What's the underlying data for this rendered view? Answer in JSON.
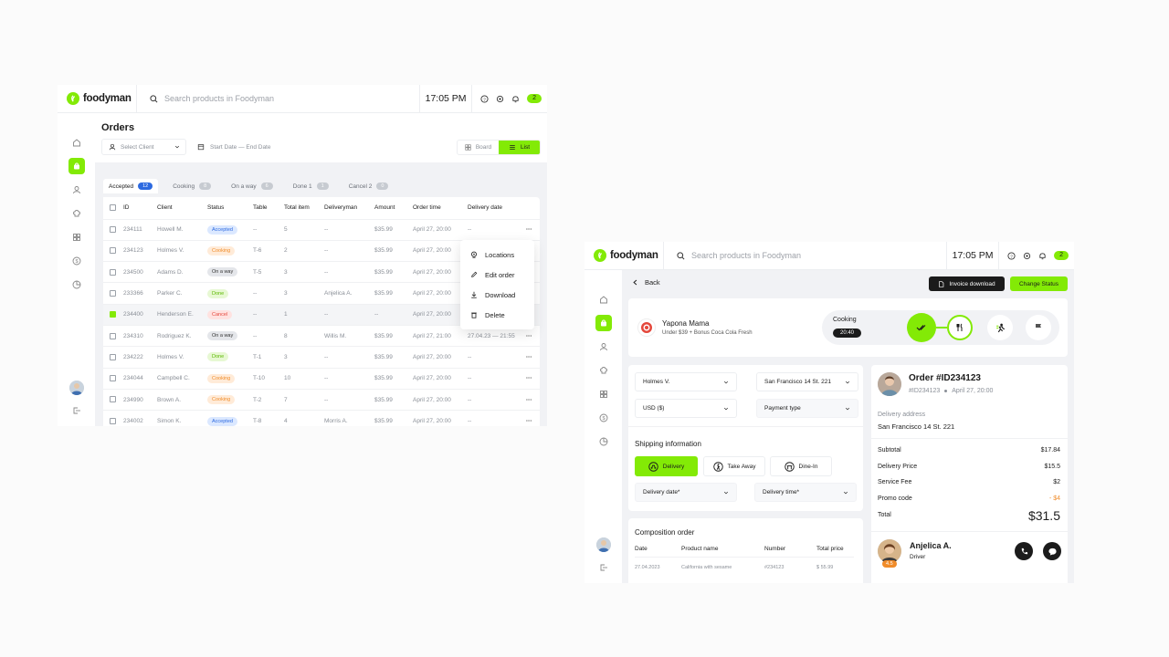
{
  "brand": "foodyman",
  "left": {
    "search_placeholder": "Search products in Foodyman",
    "time": "17:05 PM",
    "notif_count": "2",
    "page_title": "Orders",
    "client_select": "Select Client",
    "date_range": "Start Date — End Date",
    "view_board": "Board",
    "view_list": "List",
    "tabs": [
      {
        "label": "Accepted",
        "count": "12"
      },
      {
        "label": "Cooking",
        "count": "8"
      },
      {
        "label": "On a way",
        "count": "6"
      },
      {
        "label": "Done 1",
        "count": "1"
      },
      {
        "label": "Cancel 2",
        "count": "0"
      }
    ],
    "columns": [
      "ID",
      "Client",
      "Status",
      "Table",
      "Total item",
      "Deliveryman",
      "Amount",
      "Order time",
      "Delivery date"
    ],
    "rows": [
      {
        "id": "234111",
        "client": "Howell M.",
        "status": "Accepted",
        "table": "--",
        "items": "5",
        "deliveryman": "--",
        "amount": "$35.99",
        "time": "April 27, 20:00",
        "delivery": "--",
        "more": "···"
      },
      {
        "id": "234123",
        "client": "Holmes V.",
        "status": "Cooking",
        "table": "T-6",
        "items": "2",
        "deliveryman": "--",
        "amount": "$35.99",
        "time": "April 27, 20:00",
        "delivery": "",
        "more": ""
      },
      {
        "id": "234500",
        "client": "Adams D.",
        "status": "On a way",
        "table": "T-5",
        "items": "3",
        "deliveryman": "--",
        "amount": "$35.99",
        "time": "April 27, 20:00",
        "delivery": "",
        "more": ""
      },
      {
        "id": "233366",
        "client": "Parker C.",
        "status": "Done",
        "table": "--",
        "items": "3",
        "deliveryman": "Anjelica A.",
        "amount": "$35.99",
        "time": "April 27, 20:00",
        "delivery": "",
        "more": ""
      },
      {
        "id": "234400",
        "client": "Henderson E.",
        "status": "Cancel",
        "table": "--",
        "items": "1",
        "deliveryman": "--",
        "amount": "--",
        "time": "April 27, 20:00",
        "delivery": "",
        "more": ""
      },
      {
        "id": "234310",
        "client": "Rodriguez K.",
        "status": "On a way",
        "table": "--",
        "items": "8",
        "deliveryman": "Willis M.",
        "amount": "$35.99",
        "time": "April 27, 21:00",
        "delivery": "27.04.23 — 21:55",
        "more": "···"
      },
      {
        "id": "234222",
        "client": "Holmes V.",
        "status": "Done",
        "table": "T-1",
        "items": "3",
        "deliveryman": "--",
        "amount": "$35.99",
        "time": "April 27, 20:00",
        "delivery": "--",
        "more": "···"
      },
      {
        "id": "234044",
        "client": "Campbell C.",
        "status": "Cooking",
        "table": "T-10",
        "items": "10",
        "deliveryman": "--",
        "amount": "$35.99",
        "time": "April 27, 20:00",
        "delivery": "--",
        "more": "···"
      },
      {
        "id": "234990",
        "client": "Brown A.",
        "status": "Cooking",
        "table": "T-2",
        "items": "7",
        "deliveryman": "--",
        "amount": "$35.99",
        "time": "April 27, 20:00",
        "delivery": "--",
        "more": "···"
      },
      {
        "id": "234002",
        "client": "Simon K.",
        "status": "Accepted",
        "table": "T-8",
        "items": "4",
        "deliveryman": "Morris A.",
        "amount": "$35.99",
        "time": "April 27, 20:00",
        "delivery": "--",
        "more": "···"
      }
    ],
    "context_menu": [
      "Locations",
      "Edit order",
      "Download",
      "Delete"
    ]
  },
  "right": {
    "search_placeholder": "Search products in Foodyman",
    "time": "17:05 PM",
    "notif_count": "2",
    "back": "Back",
    "invoice": "Invoice download",
    "change_status": "Change Status",
    "restaurant": "Yapona Mama",
    "promo": "Under $39 + Bonus Coca Cola Fresh",
    "status_label": "Cooking",
    "status_time": "20:40",
    "client": "Holmes V.",
    "address_select": "San Francisco 14 St. 221",
    "currency": "USD ($)",
    "payment": "Payment type",
    "shipping_title": "Shipping information",
    "ship_options": [
      "Delivery",
      "Take Away",
      "Dine-In"
    ],
    "delivery_date": "Delivery date*",
    "delivery_time": "Delivery time*",
    "composition_title": "Composition order",
    "comp_columns": [
      "Date",
      "Product name",
      "Number",
      "Total price"
    ],
    "comp_row": [
      "27.04.2023",
      "California with sesame",
      "#234123",
      "$ 55.99"
    ],
    "order_title": "Order #ID234123",
    "order_id": "#ID234123",
    "order_date": "April 27, 20:00",
    "address_label": "Delivery address",
    "address": "San Francisco 14 St. 221",
    "summary": [
      {
        "label": "Subtotal",
        "value": "$17.84"
      },
      {
        "label": "Delivery Price",
        "value": "$15.5"
      },
      {
        "label": "Service Fee",
        "value": "$2"
      },
      {
        "label": "Promo code",
        "value": "- $4"
      }
    ],
    "total_label": "Total",
    "total_value": "$31.5",
    "driver_name": "Anjelica A.",
    "driver_role": "Driver",
    "driver_rating": "4.5"
  },
  "colors": {
    "accent": "#83ea06",
    "dark": "#1b1b1b",
    "blue": "#2d6ae0",
    "orange": "#f08c2a",
    "red": "#e4473b"
  }
}
